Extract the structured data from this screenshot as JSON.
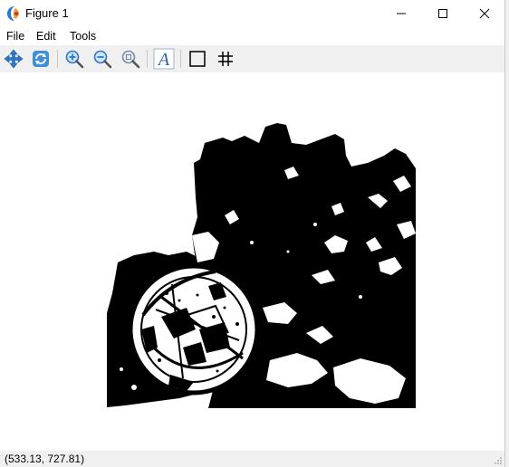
{
  "window": {
    "title": "Figure 1",
    "controls": {
      "minimize": "—",
      "maximize": "☐",
      "close": "✕"
    }
  },
  "menu": {
    "file": "File",
    "edit": "Edit",
    "tools": "Tools"
  },
  "toolbar": {
    "buttons": [
      {
        "icon": "pan-icon"
      },
      {
        "icon": "refresh-icon"
      },
      {
        "icon": "zoom-in-icon"
      },
      {
        "icon": "zoom-out-icon"
      },
      {
        "icon": "zoom-fit-icon"
      },
      {
        "icon": "text-icon",
        "glyph": "A"
      },
      {
        "icon": "square-icon"
      },
      {
        "icon": "grid-icon"
      }
    ]
  },
  "status": {
    "coordinates": "(533.13, 727.81)"
  },
  "colors": {
    "toolbar_bg": "#f0f0f0",
    "icon_blue": "#2a78c8",
    "image_black": "#000000",
    "image_white": "#ffffff"
  }
}
